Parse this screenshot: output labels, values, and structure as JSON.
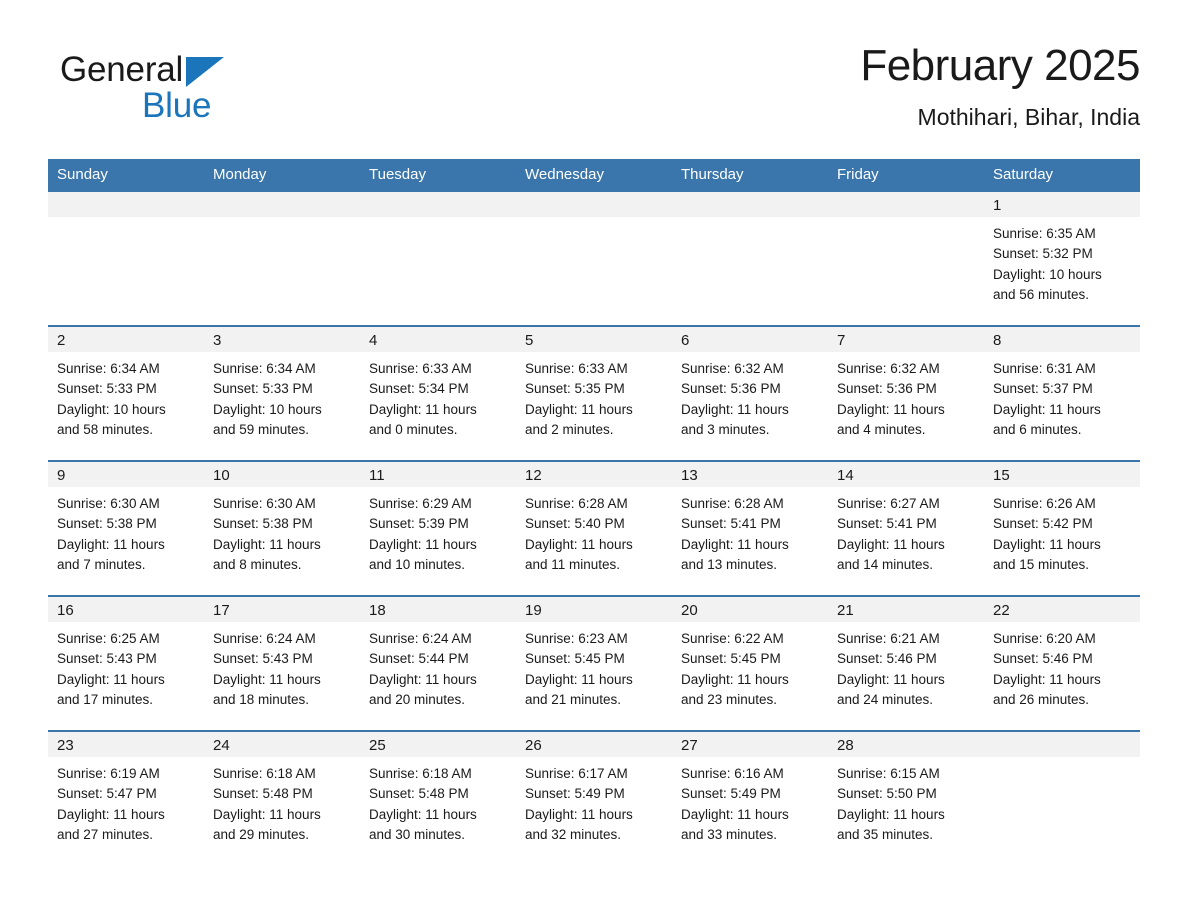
{
  "brand": {
    "name_part1": "General",
    "name_part2": "Blue",
    "logo_icon": "blue-triangle-logo"
  },
  "header": {
    "title": "February 2025",
    "subtitle": "Mothihari, Bihar, India"
  },
  "colors": {
    "header_blue": "#3a76ab",
    "brand_blue": "#1b75bb",
    "daynum_band": "#f2f2f2",
    "text": "#1a1a1a"
  },
  "weekday_headers": [
    "Sunday",
    "Monday",
    "Tuesday",
    "Wednesday",
    "Thursday",
    "Friday",
    "Saturday"
  ],
  "labels": {
    "sunrise_prefix": "Sunrise:",
    "sunset_prefix": "Sunset:",
    "daylight_prefix": "Daylight:"
  },
  "weeks": [
    [
      {
        "day": "",
        "sunrise": "",
        "sunset": "",
        "daylight_l1": "",
        "daylight_l2": ""
      },
      {
        "day": "",
        "sunrise": "",
        "sunset": "",
        "daylight_l1": "",
        "daylight_l2": ""
      },
      {
        "day": "",
        "sunrise": "",
        "sunset": "",
        "daylight_l1": "",
        "daylight_l2": ""
      },
      {
        "day": "",
        "sunrise": "",
        "sunset": "",
        "daylight_l1": "",
        "daylight_l2": ""
      },
      {
        "day": "",
        "sunrise": "",
        "sunset": "",
        "daylight_l1": "",
        "daylight_l2": ""
      },
      {
        "day": "",
        "sunrise": "",
        "sunset": "",
        "daylight_l1": "",
        "daylight_l2": ""
      },
      {
        "day": "1",
        "sunrise": "Sunrise: 6:35 AM",
        "sunset": "Sunset: 5:32 PM",
        "daylight_l1": "Daylight: 10 hours",
        "daylight_l2": "and 56 minutes."
      }
    ],
    [
      {
        "day": "2",
        "sunrise": "Sunrise: 6:34 AM",
        "sunset": "Sunset: 5:33 PM",
        "daylight_l1": "Daylight: 10 hours",
        "daylight_l2": "and 58 minutes."
      },
      {
        "day": "3",
        "sunrise": "Sunrise: 6:34 AM",
        "sunset": "Sunset: 5:33 PM",
        "daylight_l1": "Daylight: 10 hours",
        "daylight_l2": "and 59 minutes."
      },
      {
        "day": "4",
        "sunrise": "Sunrise: 6:33 AM",
        "sunset": "Sunset: 5:34 PM",
        "daylight_l1": "Daylight: 11 hours",
        "daylight_l2": "and 0 minutes."
      },
      {
        "day": "5",
        "sunrise": "Sunrise: 6:33 AM",
        "sunset": "Sunset: 5:35 PM",
        "daylight_l1": "Daylight: 11 hours",
        "daylight_l2": "and 2 minutes."
      },
      {
        "day": "6",
        "sunrise": "Sunrise: 6:32 AM",
        "sunset": "Sunset: 5:36 PM",
        "daylight_l1": "Daylight: 11 hours",
        "daylight_l2": "and 3 minutes."
      },
      {
        "day": "7",
        "sunrise": "Sunrise: 6:32 AM",
        "sunset": "Sunset: 5:36 PM",
        "daylight_l1": "Daylight: 11 hours",
        "daylight_l2": "and 4 minutes."
      },
      {
        "day": "8",
        "sunrise": "Sunrise: 6:31 AM",
        "sunset": "Sunset: 5:37 PM",
        "daylight_l1": "Daylight: 11 hours",
        "daylight_l2": "and 6 minutes."
      }
    ],
    [
      {
        "day": "9",
        "sunrise": "Sunrise: 6:30 AM",
        "sunset": "Sunset: 5:38 PM",
        "daylight_l1": "Daylight: 11 hours",
        "daylight_l2": "and 7 minutes."
      },
      {
        "day": "10",
        "sunrise": "Sunrise: 6:30 AM",
        "sunset": "Sunset: 5:38 PM",
        "daylight_l1": "Daylight: 11 hours",
        "daylight_l2": "and 8 minutes."
      },
      {
        "day": "11",
        "sunrise": "Sunrise: 6:29 AM",
        "sunset": "Sunset: 5:39 PM",
        "daylight_l1": "Daylight: 11 hours",
        "daylight_l2": "and 10 minutes."
      },
      {
        "day": "12",
        "sunrise": "Sunrise: 6:28 AM",
        "sunset": "Sunset: 5:40 PM",
        "daylight_l1": "Daylight: 11 hours",
        "daylight_l2": "and 11 minutes."
      },
      {
        "day": "13",
        "sunrise": "Sunrise: 6:28 AM",
        "sunset": "Sunset: 5:41 PM",
        "daylight_l1": "Daylight: 11 hours",
        "daylight_l2": "and 13 minutes."
      },
      {
        "day": "14",
        "sunrise": "Sunrise: 6:27 AM",
        "sunset": "Sunset: 5:41 PM",
        "daylight_l1": "Daylight: 11 hours",
        "daylight_l2": "and 14 minutes."
      },
      {
        "day": "15",
        "sunrise": "Sunrise: 6:26 AM",
        "sunset": "Sunset: 5:42 PM",
        "daylight_l1": "Daylight: 11 hours",
        "daylight_l2": "and 15 minutes."
      }
    ],
    [
      {
        "day": "16",
        "sunrise": "Sunrise: 6:25 AM",
        "sunset": "Sunset: 5:43 PM",
        "daylight_l1": "Daylight: 11 hours",
        "daylight_l2": "and 17 minutes."
      },
      {
        "day": "17",
        "sunrise": "Sunrise: 6:24 AM",
        "sunset": "Sunset: 5:43 PM",
        "daylight_l1": "Daylight: 11 hours",
        "daylight_l2": "and 18 minutes."
      },
      {
        "day": "18",
        "sunrise": "Sunrise: 6:24 AM",
        "sunset": "Sunset: 5:44 PM",
        "daylight_l1": "Daylight: 11 hours",
        "daylight_l2": "and 20 minutes."
      },
      {
        "day": "19",
        "sunrise": "Sunrise: 6:23 AM",
        "sunset": "Sunset: 5:45 PM",
        "daylight_l1": "Daylight: 11 hours",
        "daylight_l2": "and 21 minutes."
      },
      {
        "day": "20",
        "sunrise": "Sunrise: 6:22 AM",
        "sunset": "Sunset: 5:45 PM",
        "daylight_l1": "Daylight: 11 hours",
        "daylight_l2": "and 23 minutes."
      },
      {
        "day": "21",
        "sunrise": "Sunrise: 6:21 AM",
        "sunset": "Sunset: 5:46 PM",
        "daylight_l1": "Daylight: 11 hours",
        "daylight_l2": "and 24 minutes."
      },
      {
        "day": "22",
        "sunrise": "Sunrise: 6:20 AM",
        "sunset": "Sunset: 5:46 PM",
        "daylight_l1": "Daylight: 11 hours",
        "daylight_l2": "and 26 minutes."
      }
    ],
    [
      {
        "day": "23",
        "sunrise": "Sunrise: 6:19 AM",
        "sunset": "Sunset: 5:47 PM",
        "daylight_l1": "Daylight: 11 hours",
        "daylight_l2": "and 27 minutes."
      },
      {
        "day": "24",
        "sunrise": "Sunrise: 6:18 AM",
        "sunset": "Sunset: 5:48 PM",
        "daylight_l1": "Daylight: 11 hours",
        "daylight_l2": "and 29 minutes."
      },
      {
        "day": "25",
        "sunrise": "Sunrise: 6:18 AM",
        "sunset": "Sunset: 5:48 PM",
        "daylight_l1": "Daylight: 11 hours",
        "daylight_l2": "and 30 minutes."
      },
      {
        "day": "26",
        "sunrise": "Sunrise: 6:17 AM",
        "sunset": "Sunset: 5:49 PM",
        "daylight_l1": "Daylight: 11 hours",
        "daylight_l2": "and 32 minutes."
      },
      {
        "day": "27",
        "sunrise": "Sunrise: 6:16 AM",
        "sunset": "Sunset: 5:49 PM",
        "daylight_l1": "Daylight: 11 hours",
        "daylight_l2": "and 33 minutes."
      },
      {
        "day": "28",
        "sunrise": "Sunrise: 6:15 AM",
        "sunset": "Sunset: 5:50 PM",
        "daylight_l1": "Daylight: 11 hours",
        "daylight_l2": "and 35 minutes."
      },
      {
        "day": "",
        "sunrise": "",
        "sunset": "",
        "daylight_l1": "",
        "daylight_l2": ""
      }
    ]
  ]
}
